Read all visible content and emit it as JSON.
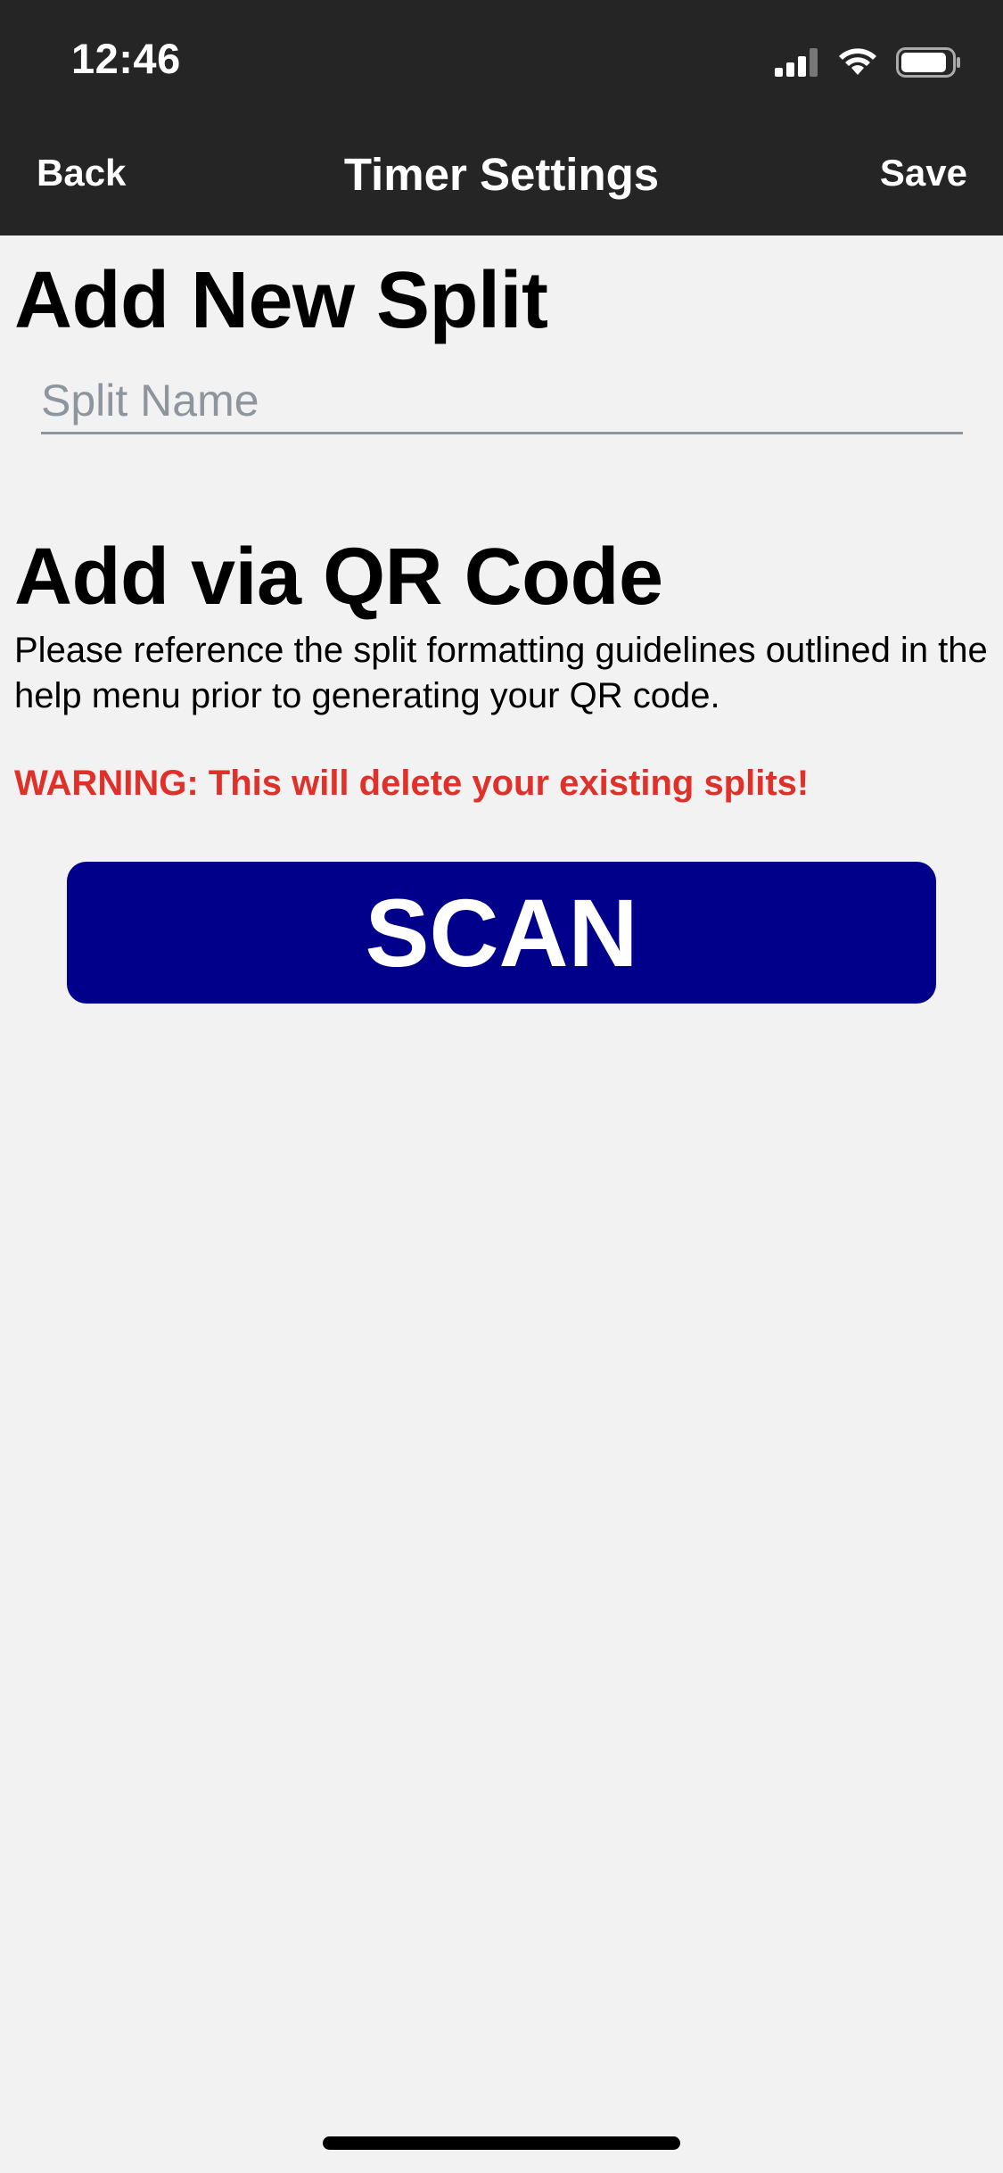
{
  "status_bar": {
    "time": "12:46",
    "icons": [
      "signal-icon",
      "wifi-icon",
      "battery-icon"
    ]
  },
  "nav": {
    "back_label": "Back",
    "title": "Timer Settings",
    "save_label": "Save"
  },
  "add_split": {
    "heading": "Add New Split",
    "input_placeholder": "Split Name",
    "input_value": ""
  },
  "qr": {
    "heading": "Add via QR Code",
    "help_text": "Please reference the split formatting guidelines outlined in the help menu prior to generating your QR code.",
    "warning": "WARNING: This will delete your existing splits!",
    "scan_label": "SCAN"
  },
  "colors": {
    "nav_background": "#252525",
    "page_background": "#f2f2f2",
    "scan_button": "#00008a",
    "warning_text": "#e0302a",
    "placeholder": "#8e959d"
  }
}
